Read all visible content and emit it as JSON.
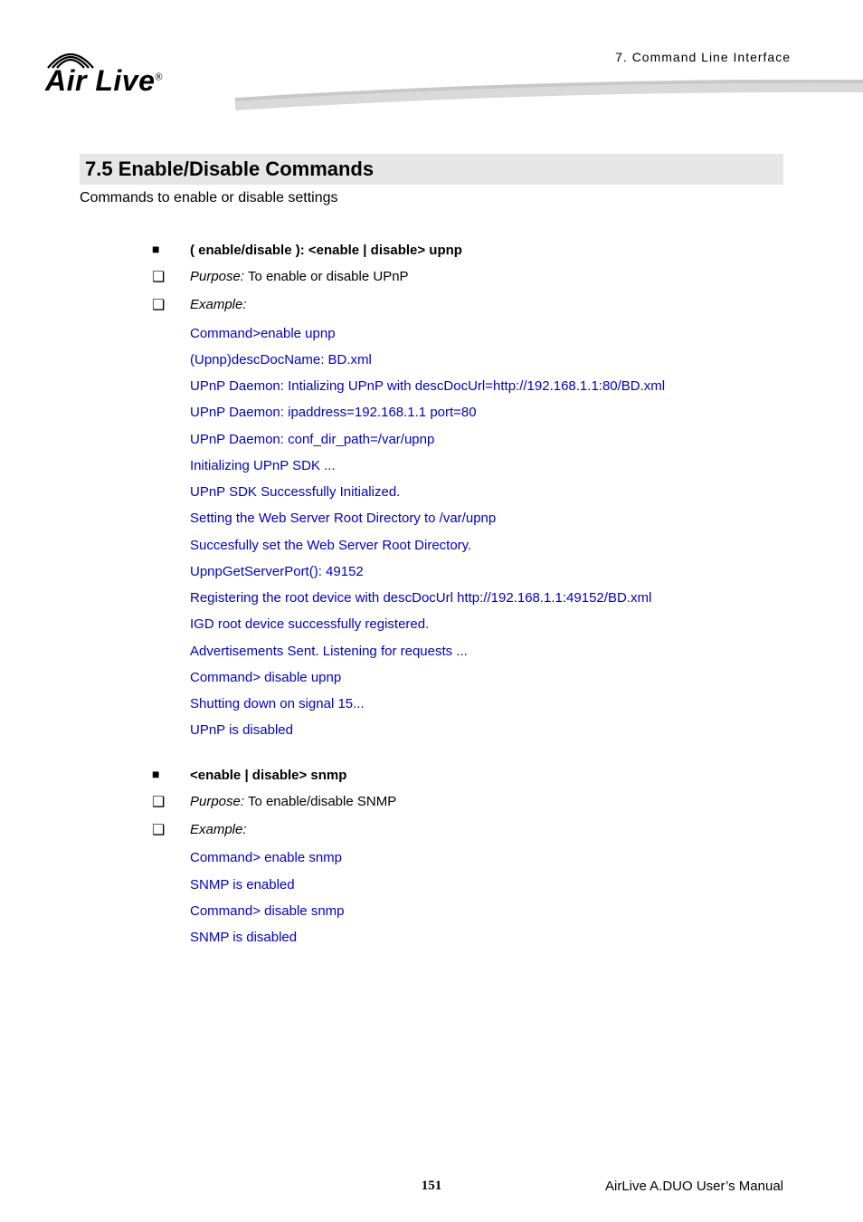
{
  "header": {
    "logo_text": "Air Live",
    "chapter": "7. Command Line Interface"
  },
  "section": {
    "title": "7.5 Enable/Disable Commands",
    "intro": "Commands to enable or disable settings"
  },
  "item1": {
    "heading": "( enable/disable ):   <enable | disable> upnp",
    "purpose_label": "Purpose:",
    "purpose_text": "   To enable or disable UPnP",
    "example_label": "Example:",
    "lines": [
      "Command>enable upnp",
      "(Upnp)descDocName: BD.xml",
      "UPnP Daemon: Intializing UPnP with descDocUrl=http://192.168.1.1:80/BD.xml",
      "UPnP Daemon: ipaddress=192.168.1.1 port=80",
      "UPnP Daemon: conf_dir_path=/var/upnp",
      "Initializing UPnP SDK ...",
      "UPnP SDK Successfully Initialized.",
      "Setting the Web Server Root Directory to /var/upnp",
      "Succesfully set the Web Server Root Directory.",
      "UpnpGetServerPort(): 49152",
      "Registering the root device with descDocUrl http://192.168.1.1:49152/BD.xml",
      "IGD root device successfully registered.",
      "Advertisements Sent.   Listening for requests ...",
      "Command> disable upnp",
      "Shutting down on signal 15...",
      "UPnP is disabled"
    ]
  },
  "item2": {
    "heading": "<enable | disable> snmp",
    "purpose_label": "Purpose:",
    "purpose_text": " To enable/disable SNMP",
    "example_label": "Example:",
    "lines": [
      "Command> enable snmp",
      "SNMP is enabled",
      "Command> disable snmp",
      "SNMP is disabled"
    ]
  },
  "footer": {
    "page": "151",
    "manual": "AirLive A.DUO User’s Manual"
  }
}
